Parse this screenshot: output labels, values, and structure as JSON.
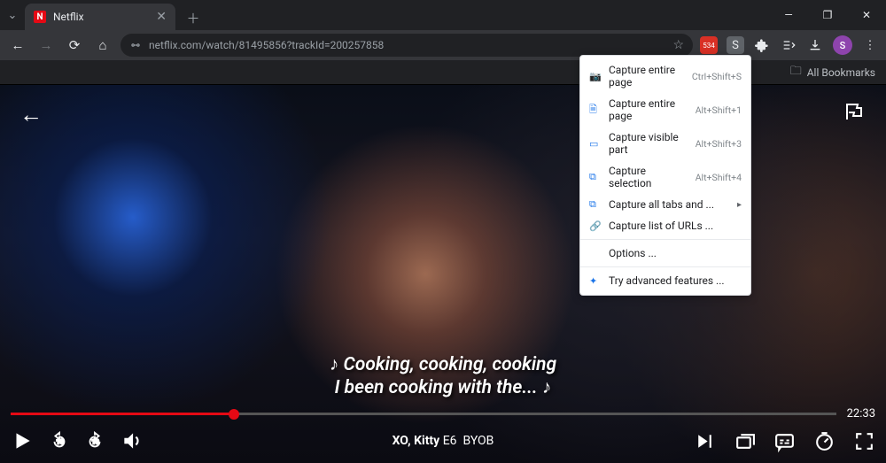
{
  "browser": {
    "tab_title": "Netflix",
    "url": "netflix.com/watch/81495856?trackId=200257858",
    "bookmarks_label": "All Bookmarks",
    "avatar_letter": "S"
  },
  "ext_menu": {
    "items": [
      {
        "icon": "📷",
        "label": "Capture entire page",
        "shortcut": "Ctrl+Shift+S"
      },
      {
        "icon": "🗎",
        "label": "Capture entire page",
        "shortcut": "Alt+Shift+1"
      },
      {
        "icon": "▭",
        "label": "Capture visible part",
        "shortcut": "Alt+Shift+3"
      },
      {
        "icon": "⧉",
        "label": "Capture selection",
        "shortcut": "Alt+Shift+4"
      },
      {
        "icon": "⧉",
        "label": "Capture all tabs and ...",
        "arrow": true
      },
      {
        "icon": "🔗",
        "label": "Capture list of URLs ..."
      }
    ],
    "options_label": "Options ...",
    "try_label": "Try advanced features ..."
  },
  "player": {
    "subtitle_line1": "♪ Cooking, cooking, cooking",
    "subtitle_line2": "I been cooking with the... ♪",
    "series": "XO, Kitty",
    "episode_code": "E6",
    "episode_title": "BYOB",
    "time_remaining": "22:33",
    "progress_percent": 27
  }
}
